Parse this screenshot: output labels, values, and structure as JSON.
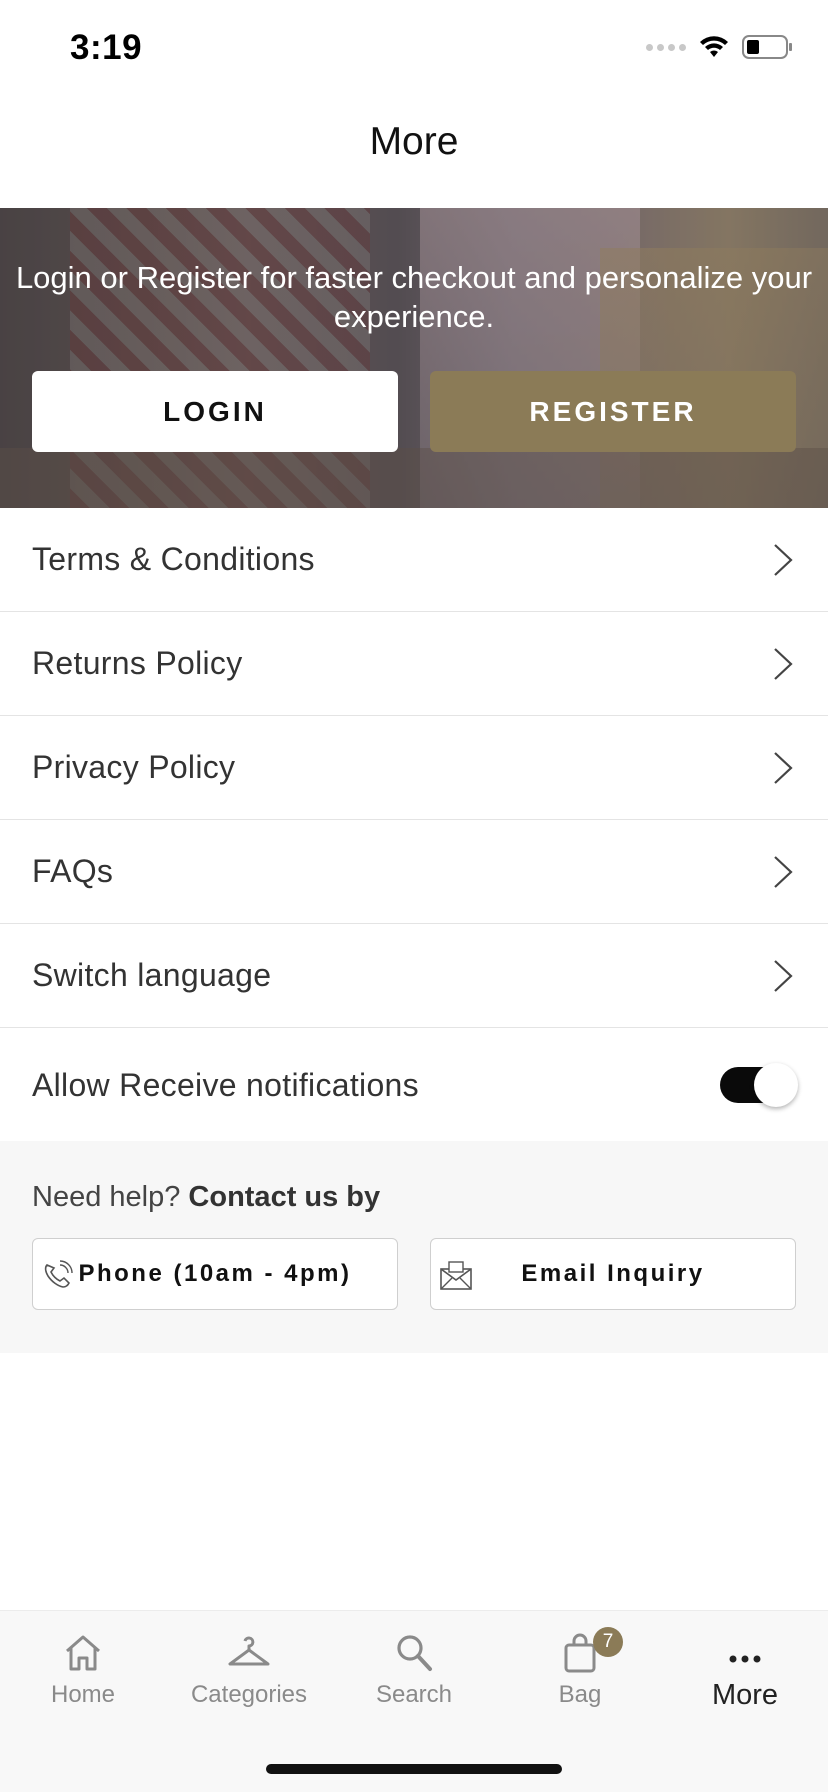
{
  "status_bar": {
    "time": "3:19"
  },
  "header": {
    "title": "More"
  },
  "hero": {
    "text": "Login or Register for faster checkout and personalize your experience.",
    "login_label": "LOGIN",
    "register_label": "REGISTER"
  },
  "menu": {
    "items": [
      {
        "label": "Terms & Conditions"
      },
      {
        "label": "Returns Policy"
      },
      {
        "label": "Privacy Policy"
      },
      {
        "label": "FAQs"
      },
      {
        "label": "Switch language"
      }
    ],
    "notifications_label": "Allow Receive notifications",
    "notifications_enabled": true
  },
  "help": {
    "prefix": "Need help?",
    "emphasis": "Contact us by",
    "phone_label": "Phone (10am - 4pm)",
    "email_label": "Email Inquiry"
  },
  "tabbar": {
    "tabs": [
      {
        "label": "Home",
        "icon": "home-icon"
      },
      {
        "label": "Categories",
        "icon": "hanger-icon"
      },
      {
        "label": "Search",
        "icon": "search-icon"
      },
      {
        "label": "Bag",
        "icon": "bag-icon",
        "badge": "7"
      },
      {
        "label": "More",
        "icon": "more-icon",
        "active": true
      }
    ]
  },
  "colors": {
    "accent": "#8b7b57",
    "toggle_on": "#0a0a0a"
  }
}
